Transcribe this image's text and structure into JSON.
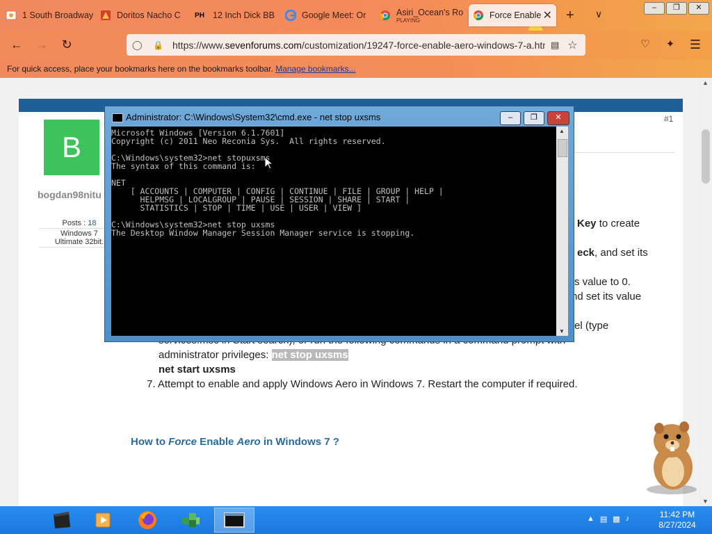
{
  "window": {
    "minimize_label": "–",
    "restore_label": "❐",
    "close_label": "✕"
  },
  "tabs": [
    {
      "label": "1 South Broadway",
      "icon": "restaurant-icon"
    },
    {
      "label": "Doritos Nacho C",
      "icon": "doritos-icon"
    },
    {
      "label": "12 Inch Dick BB",
      "icon": "ph-icon",
      "icon_text": "PH"
    },
    {
      "label": "Google Meet: Or",
      "icon": "google-icon"
    },
    {
      "label": "Asiri_Ocean's Ro",
      "sub": "PLAYING",
      "icon": "chrome-icon"
    },
    {
      "label": "Force Enable",
      "icon": "chrome-icon",
      "active": true
    }
  ],
  "toolbar": {
    "new_tab": "+",
    "tab_list": "∨",
    "url_prefix": "https://www.",
    "url_domain": "sevenforums.com",
    "url_path": "/customization/19247-force-enable-aero-windows-7-a.htm"
  },
  "bookmarks": {
    "text": "For quick access, place your bookmarks here on the bookmarks toolbar.",
    "link": "Manage bookmarks..."
  },
  "post": {
    "number": "#1",
    "avatar_letter": "B",
    "username": "bogdan98nitu",
    "posts_label": "Posts :",
    "posts_count": "18",
    "os_line1": "Windows 7",
    "os_line2": "Ultimate 32bit.",
    "frag_key_bold": "Key",
    "frag_key_rest": " to create",
    "frag_eck_bold": "eck",
    "frag_eck_rest": ", and set its",
    "frag_value0": "s value to 0.",
    "frag_setvalue": "nd set its value",
    "frag_type": "el (type",
    "frag_services": "services.msc in Start search), or run the following commands in a command prompt with",
    "frag_admin": "administrator privileges: ",
    "highlight": "net stop uxsms",
    "net_start": "net start uxsms",
    "step7": "7. Attempt to enable and apply Windows Aero in Windows 7. Restart the computer if required.",
    "howto_1": "How to ",
    "howto_force": "Force",
    "howto_2": " Enable ",
    "howto_aero": "Aero",
    "howto_3": " in Windows 7 ?"
  },
  "cmd": {
    "title": "Administrator: C:\\Windows\\System32\\cmd.exe - net  stop uxsms",
    "console_text": "Microsoft Windows [Version 6.1.7601]\nCopyright (c) 2011 Neo Reconia Sys.  All rights reserved.\n\nC:\\Windows\\system32>net stopuxsms\nThe syntax of this command is:\n\nNET\n    [ ACCOUNTS | COMPUTER | CONFIG | CONTINUE | FILE | GROUP | HELP |\n      HELPMSG | LOCALGROUP | PAUSE | SESSION | SHARE | START |\n      STATISTICS | STOP | TIME | USE | USER | VIEW ]\n\nC:\\Windows\\system32>net stop uxsms\nThe Desktop Window Manager Session Manager service is stopping."
  },
  "taskbar": {
    "items": [
      "start-icon",
      "media-icon",
      "firefox-icon",
      "puzzle-icon",
      "cmd-icon"
    ],
    "time": "11:42 PM",
    "date": "8/27/2024"
  },
  "colors": {
    "accent": "#1f5f97",
    "avatar": "#3ec25b",
    "tabbar": "#f58a5b",
    "taskbar": "#1a78dd"
  }
}
